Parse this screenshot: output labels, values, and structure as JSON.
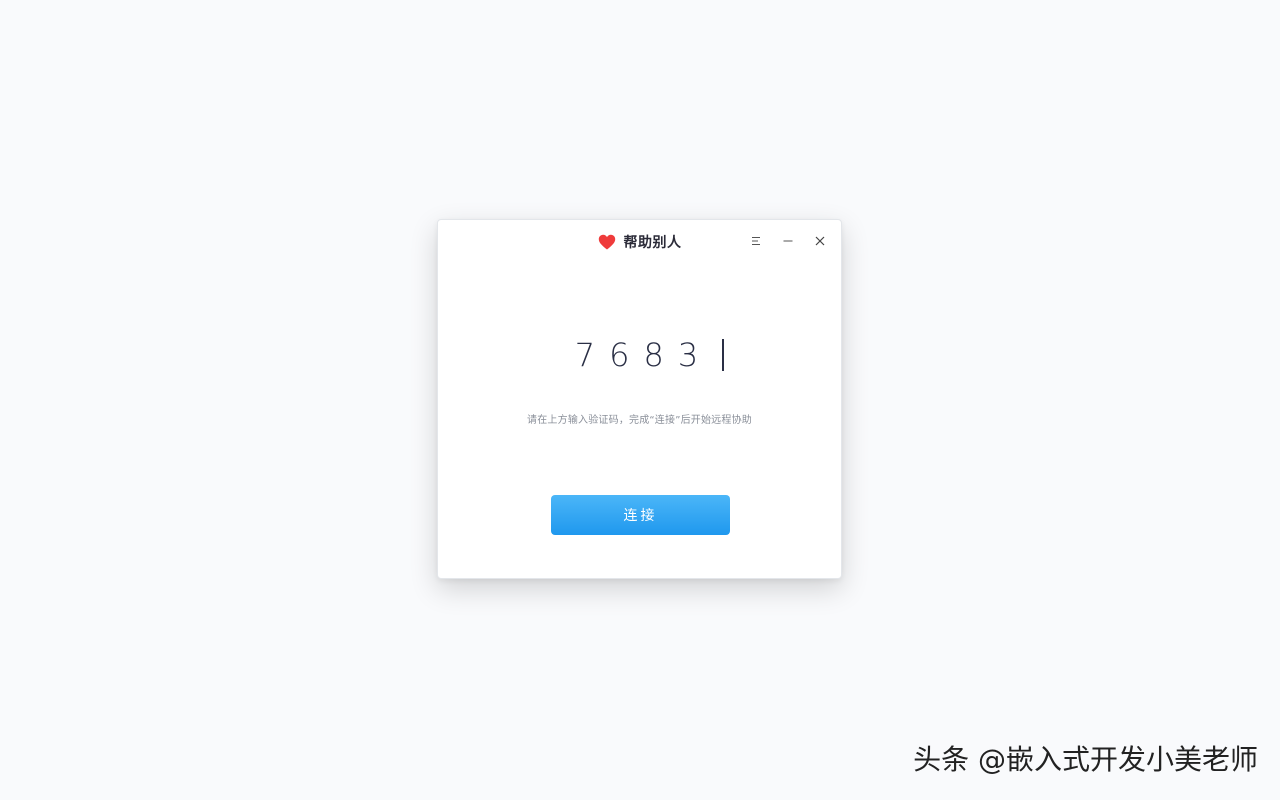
{
  "window": {
    "title": "帮助别人",
    "controls": {
      "menu_icon": "menu-icon",
      "minimize_icon": "minimize-icon",
      "close_icon": "close-icon"
    }
  },
  "code_input": {
    "value": "7683"
  },
  "hint": "请在上方输入验证码，完成“连接”后开始远程协助",
  "connect_button": {
    "label": "连接"
  },
  "watermark": "头条 @嵌入式开发小美老师",
  "colors": {
    "background": "#f9fafc",
    "accent": "#1f98ee",
    "heart": "#ef3b3b",
    "text": "#2a2f45"
  }
}
